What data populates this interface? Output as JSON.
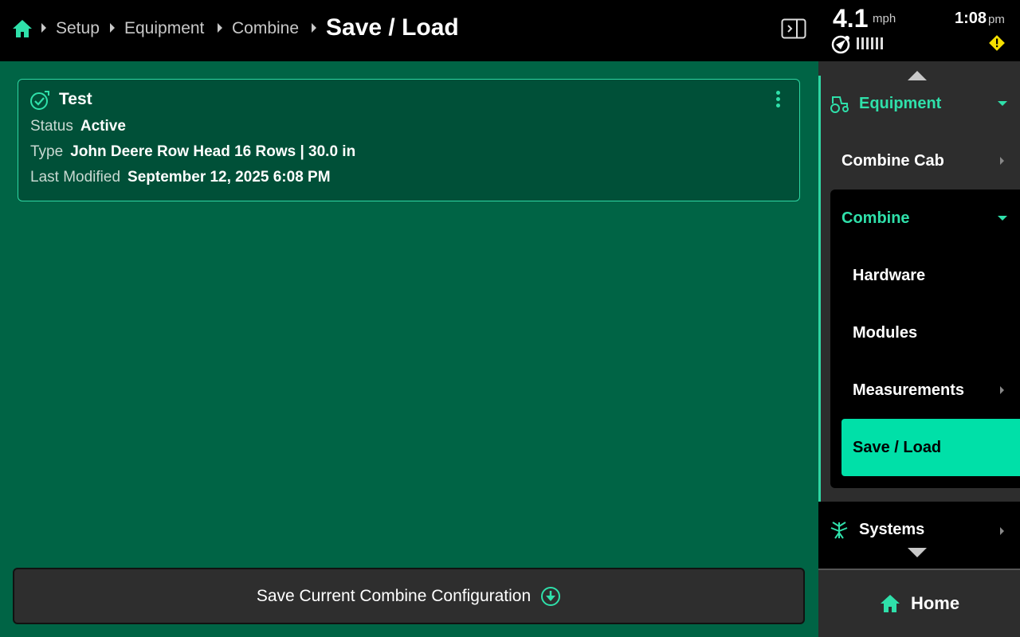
{
  "header": {
    "breadcrumbs": [
      "Setup",
      "Equipment",
      "Combine"
    ],
    "current": "Save / Load"
  },
  "card": {
    "title": "Test",
    "status_label": "Status",
    "status_value": "Active",
    "type_label": "Type",
    "type_value": "John Deere Row Head 16 Rows | 30.0 in",
    "modified_label": "Last Modified",
    "modified_value": "September 12, 2025 6:08 PM"
  },
  "save_button": {
    "label": "Save Current Combine Configuration"
  },
  "status_bar": {
    "speed": "4.1",
    "speed_unit": "mph",
    "time": "1:08",
    "time_unit": "pm"
  },
  "nav": {
    "equipment": "Equipment",
    "combine_cab": "Combine Cab",
    "combine": "Combine",
    "hardware": "Hardware",
    "modules": "Modules",
    "measurements": "Measurements",
    "save_load": "Save / Load",
    "systems": "Systems",
    "home": "Home"
  },
  "colors": {
    "accent": "#2fe0aa",
    "main_bg": "#006445",
    "card_bg": "#005038",
    "selected_bg": "#00e0a8",
    "warning": "#f5e000"
  }
}
